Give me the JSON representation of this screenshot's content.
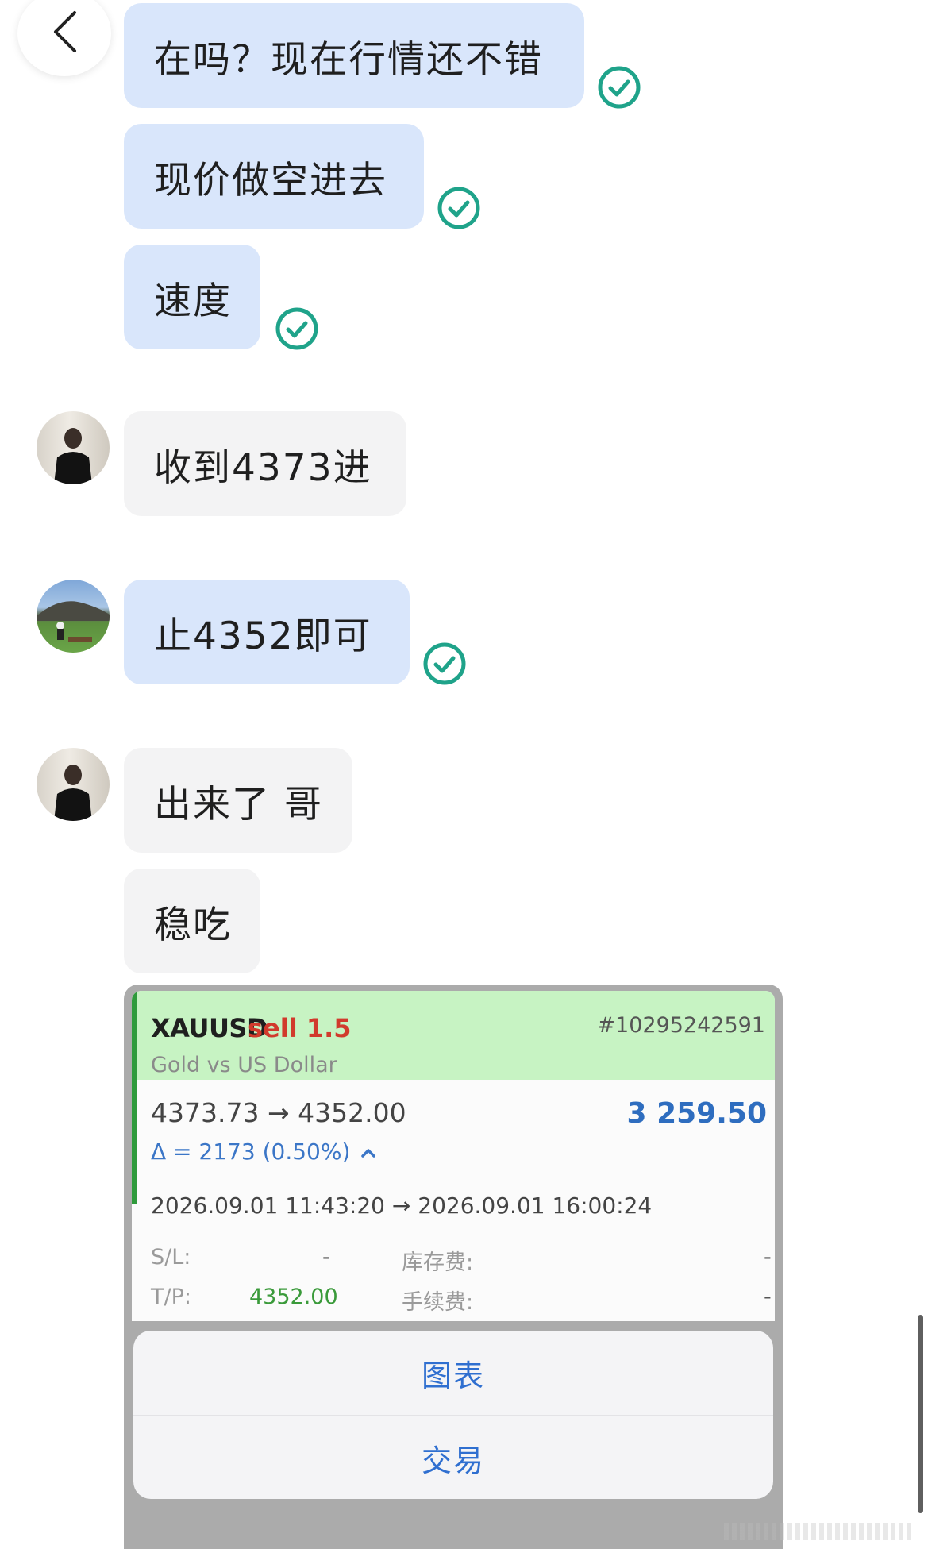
{
  "icons": {
    "back": "chevron-left-icon",
    "check": "check-circle-icon",
    "arrow": "right-arrow-icon",
    "caret": "caret-up-icon"
  },
  "colors": {
    "outgoing_bubble": "#d9e6fb",
    "incoming_bubble": "#f3f3f4",
    "check": "#1fa38a",
    "trade_header": "#c7f3c3",
    "sell": "#d13a2c",
    "profit": "#2e6dbf",
    "tp": "#3a9a3a",
    "action_text": "#2f6fd0"
  },
  "messages": [
    {
      "direction": "out",
      "text": "在吗？现在行情还不错",
      "read": true
    },
    {
      "direction": "out",
      "text": "现价做空进去",
      "read": true
    },
    {
      "direction": "out",
      "text": "速度",
      "read": true
    },
    {
      "direction": "in",
      "text": "收到4373进",
      "read": false
    },
    {
      "direction": "out",
      "text": "止4352即可",
      "read": true
    },
    {
      "direction": "in",
      "text": "出来了 哥",
      "read": false
    },
    {
      "direction": "in",
      "text": "稳吃",
      "read": false
    }
  ],
  "trade": {
    "symbol": "XAUUSD",
    "side": "sell",
    "volume": "1.5",
    "ticket": "#10295242591",
    "description": "Gold vs US Dollar",
    "open_price": "4373.73",
    "close_price": "4352.00",
    "arrow": "→",
    "profit": "3 259.50",
    "delta": "Δ = 2173 (0.50%)",
    "open_time": "2026.09.01 11:43:20",
    "close_time": "2026.09.01 16:00:24",
    "sl_label": "S/L:",
    "sl_value": "-",
    "tp_label": "T/P:",
    "tp_value": "4352.00",
    "swap_label": "库存费:",
    "swap_value": "-",
    "commission_label": "手续费:",
    "commission_value": "-"
  },
  "action_sheet": {
    "chart_label": "图表",
    "trade_label": "交易"
  }
}
